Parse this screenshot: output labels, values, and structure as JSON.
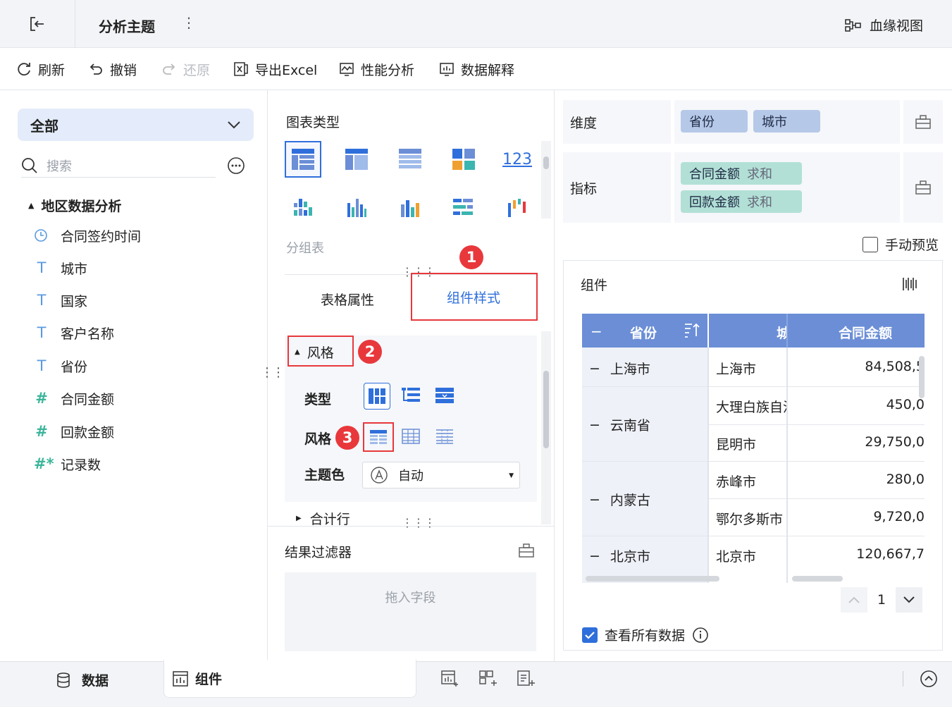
{
  "header": {
    "title": "分析主题",
    "lineage_label": "血缘视图"
  },
  "toolbar": {
    "refresh": "刷新",
    "undo": "撤销",
    "redo": "还原",
    "export": "导出Excel",
    "performance": "性能分析",
    "explain": "数据解释"
  },
  "left_panel": {
    "dropdown_value": "全部",
    "search_placeholder": "搜索",
    "group_title": "地区数据分析",
    "fields": [
      {
        "label": "合同签约时间",
        "icon": "clock-icon"
      },
      {
        "label": "城市",
        "icon": "text-field-icon"
      },
      {
        "label": "国家",
        "icon": "text-field-icon"
      },
      {
        "label": "客户名称",
        "icon": "text-field-icon"
      },
      {
        "label": "省份",
        "icon": "text-field-icon"
      },
      {
        "label": "合同金额",
        "icon": "number-field-icon"
      },
      {
        "label": "回款金额",
        "icon": "number-field-icon"
      },
      {
        "label": "记录数",
        "icon": "count-field-icon"
      }
    ]
  },
  "middle_panel": {
    "chart_type_label": "图表类型",
    "chart_subtype_label": "分组表",
    "tab_table_props": "表格属性",
    "tab_component_style": "组件样式",
    "section_style": "风格",
    "type_label": "类型",
    "style_label": "风格",
    "theme_label": "主题色",
    "theme_value": "自动",
    "section_total_row": "合计行",
    "result_filter_label": "结果过滤器",
    "drop_hint": "拖入字段",
    "badges": [
      "1",
      "2",
      "3"
    ]
  },
  "right_panel": {
    "dimension_label": "维度",
    "dimensions": [
      "省份",
      "城市"
    ],
    "metric_label": "指标",
    "metrics": [
      {
        "name": "合同金额",
        "agg": "求和"
      },
      {
        "name": "回款金额",
        "agg": "求和"
      }
    ],
    "manual_preview": "手动预览",
    "component_label": "组件",
    "table": {
      "headers": [
        "省份",
        "城",
        "合同金额"
      ],
      "rows": [
        {
          "province": "上海市",
          "city": "上海市",
          "amount": "84,508,5"
        },
        {
          "province": "云南省",
          "city": "大理白族自治",
          "amount": "450,0"
        },
        {
          "province": "",
          "city": "昆明市",
          "amount": "29,750,0"
        },
        {
          "province": "内蒙古",
          "city": "赤峰市",
          "amount": "280,0"
        },
        {
          "province": "",
          "city": "鄂尔多斯市",
          "amount": "9,720,0"
        },
        {
          "province": "北京市",
          "city": "北京市",
          "amount": "120,667,7"
        }
      ]
    },
    "page_number": "1",
    "view_all_data": "查看所有数据"
  },
  "bottom_bar": {
    "data_tab": "数据",
    "component_tab": "组件"
  },
  "colors": {
    "accent": "#2f6fdb",
    "header_blue": "#6b8ed6",
    "dimension_pill": "#b6c8e8",
    "metric_pill": "#b2e0d6",
    "highlight_red": "#e8383c"
  }
}
